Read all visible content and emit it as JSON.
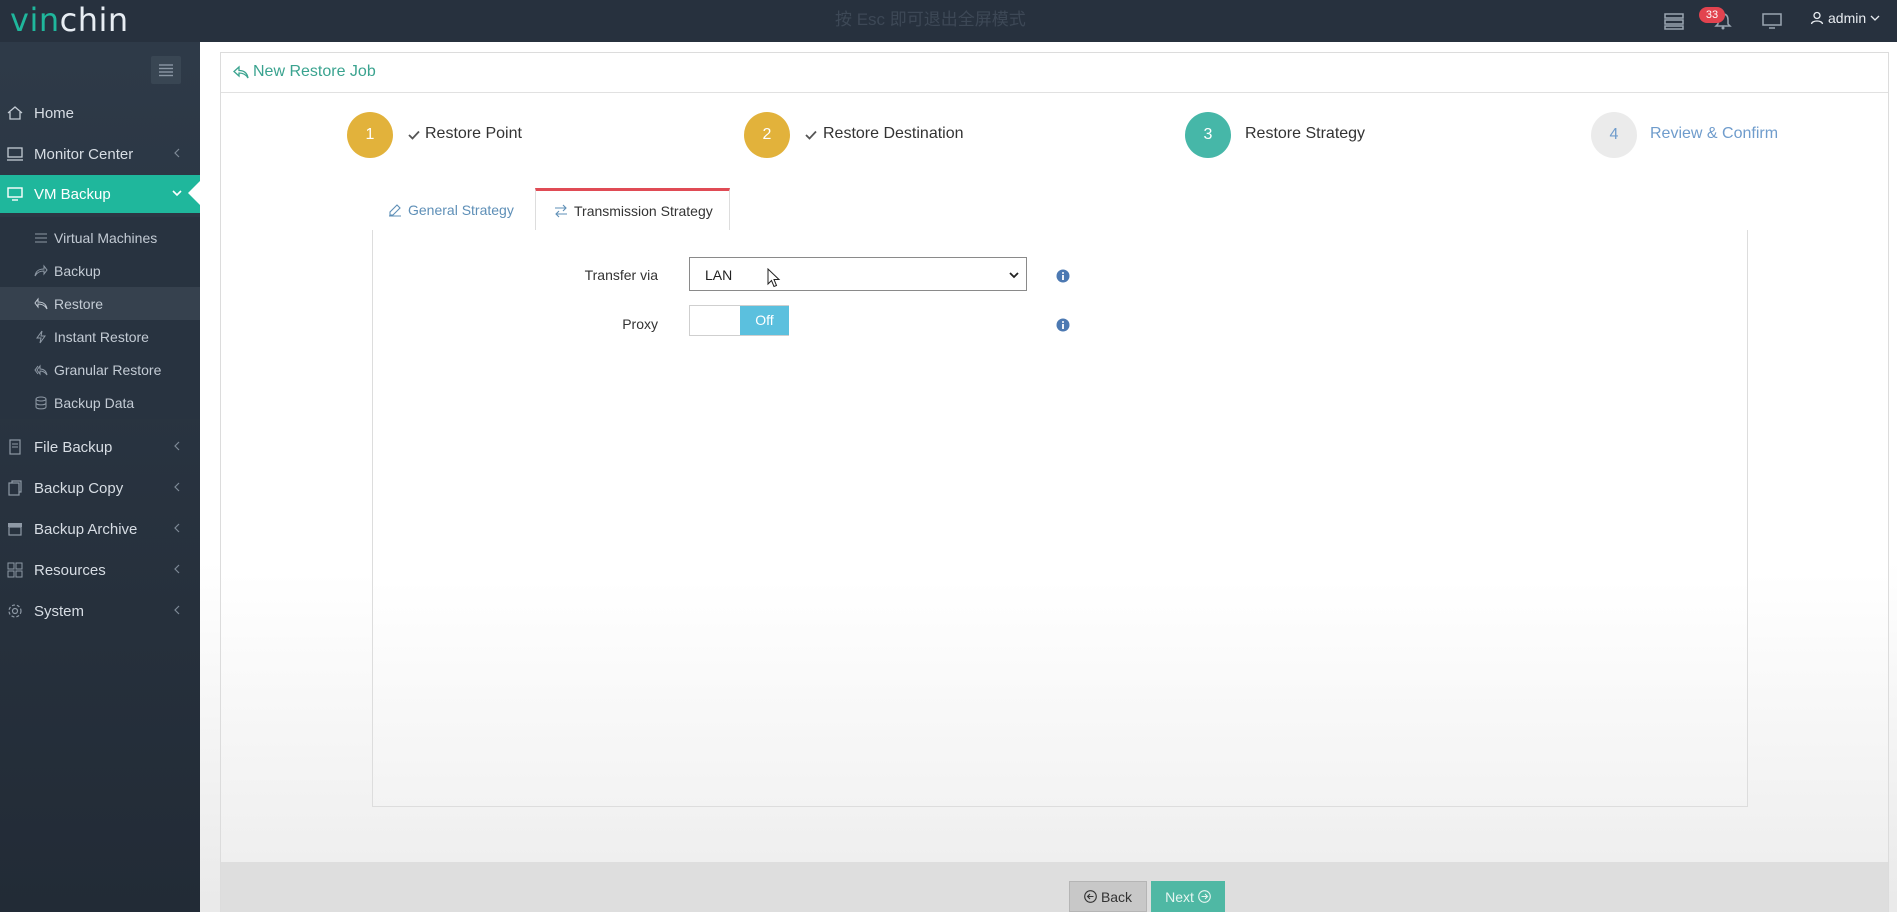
{
  "header": {
    "logo_part1": "vin",
    "logo_part2": "chin",
    "esc_hint": "按 Esc 即可退出全屏模式",
    "notification_count": "33",
    "user": "admin"
  },
  "sidebar": {
    "items": [
      {
        "label": "Home",
        "icon": "home-icon"
      },
      {
        "label": "Monitor Center",
        "icon": "monitor-icon"
      },
      {
        "label": "VM Backup",
        "icon": "desktop-icon"
      },
      {
        "label": "File Backup",
        "icon": "file-icon"
      },
      {
        "label": "Backup Copy",
        "icon": "copy-icon"
      },
      {
        "label": "Backup Archive",
        "icon": "archive-icon"
      },
      {
        "label": "Resources",
        "icon": "resources-icon"
      },
      {
        "label": "System",
        "icon": "gear-icon"
      }
    ],
    "submenu": [
      {
        "label": "Virtual Machines",
        "icon": "list-icon"
      },
      {
        "label": "Backup",
        "icon": "share-icon"
      },
      {
        "label": "Restore",
        "icon": "reply-icon"
      },
      {
        "label": "Instant Restore",
        "icon": "bolt-icon"
      },
      {
        "label": "Granular Restore",
        "icon": "reply-all-icon"
      },
      {
        "label": "Backup Data",
        "icon": "database-icon"
      }
    ]
  },
  "page": {
    "title": "New Restore Job"
  },
  "steps": [
    {
      "number": "1",
      "label": "Restore Point",
      "state": "done",
      "color": "#e2b23b"
    },
    {
      "number": "2",
      "label": "Restore Destination",
      "state": "done",
      "color": "#e2b23b"
    },
    {
      "number": "3",
      "label": "Restore Strategy",
      "state": "current",
      "color": "#46b7a8"
    },
    {
      "number": "4",
      "label": "Review & Confirm",
      "state": "pending",
      "color": "#ebebeb"
    }
  ],
  "tabs": {
    "general": "General Strategy",
    "transmission": "Transmission Strategy"
  },
  "form": {
    "transfer_label": "Transfer via",
    "transfer_value": "LAN",
    "proxy_label": "Proxy",
    "proxy_state": "Off"
  },
  "buttons": {
    "back": "Back",
    "next": "Next"
  }
}
